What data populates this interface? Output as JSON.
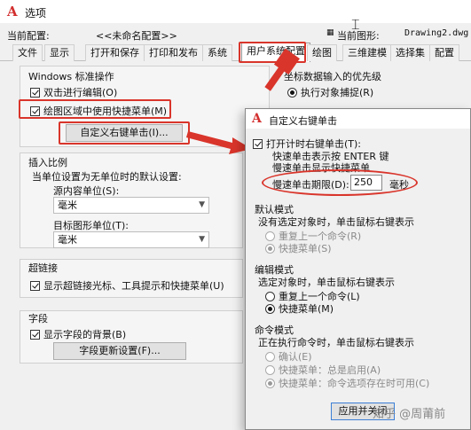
{
  "window": {
    "title": "选项"
  },
  "config": {
    "current_config_label": "当前配置:",
    "current_config_value": "<<未命名配置>>",
    "current_drawing_label": "当前图形:",
    "current_drawing_value": "Drawing2.dwg"
  },
  "tabs": [
    "文件",
    "显示",
    "打开和保存",
    "打印和发布",
    "系统",
    "用户系统配置",
    "绘图",
    "三维建模",
    "选择集",
    "配置"
  ],
  "left": {
    "windows_group": "Windows 标准操作",
    "dblclick_edit": "双击进行编辑(O)",
    "shortcut_menu": "绘图区域中使用快捷菜单(M)",
    "custom_rightclick_btn": "自定义右键单击(I)...",
    "insert_scale_group": "插入比例",
    "default_setting_label": "当单位设置为无单位时的默认设置:",
    "source_unit_label": "源内容单位(S):",
    "source_unit_value": "毫米",
    "target_unit_label": "目标图形单位(T):",
    "target_unit_value": "毫米",
    "hyperlink_group": "超链接",
    "hyperlink_check": "显示超链接光标、工具提示和快捷菜单(U)",
    "field_group": "字段",
    "field_bg_check": "显示字段的背景(B)",
    "field_update_btn": "字段更新设置(F)..."
  },
  "right_partial": {
    "coord_priority": "坐标数据输入的优先级",
    "exec_osnap": "执行对象捕捉(R)"
  },
  "dialog": {
    "title": "自定义右键单击",
    "timed_check": "打开计时右键单击(T):",
    "quick_desc": "快速单击表示按 ENTER 键",
    "slow_desc": "慢速单击显示快捷菜单",
    "slow_duration_label": "慢速单击期限(D):",
    "slow_duration_value": "250",
    "ms_label": "毫秒",
    "default_mode_group": "默认模式",
    "default_mode_desc": "没有选定对象时，单击鼠标右键表示",
    "default_repeat": "重复上一个命令(R)",
    "default_shortcut": "快捷菜单(S)",
    "edit_mode_group": "编辑模式",
    "edit_mode_desc": "选定对象时，单击鼠标右键表示",
    "edit_repeat": "重复上一个命令(L)",
    "edit_shortcut": "快捷菜单(M)",
    "cmd_mode_group": "命令模式",
    "cmd_mode_desc": "正在执行命令时，单击鼠标右键表示",
    "cmd_confirm": "确认(E)",
    "cmd_shortcut_always": "快捷菜单：总是启用(A)",
    "cmd_shortcut_options": "快捷菜单：命令选项存在时可用(C)",
    "apply_close_btn": "应用并关闭"
  },
  "watermark": "知乎 @周莆前",
  "colors": {
    "annotation_red": "#d9352b",
    "logo_red": "#d32f2f"
  }
}
